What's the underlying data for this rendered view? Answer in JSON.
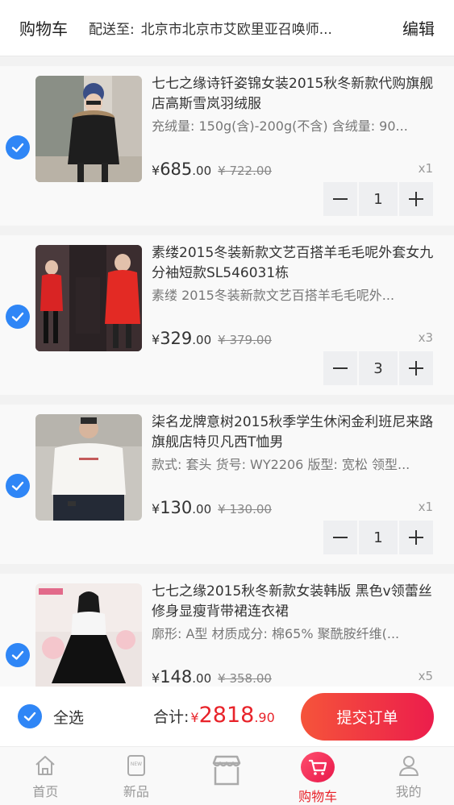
{
  "header": {
    "title": "购物车",
    "address_label": "配送至:",
    "address": "北京市北京市艾欧里亚召唤师...",
    "edit_label": "编辑"
  },
  "cart_items": [
    {
      "name": "七七之缘诗钎姿锦女装2015秋冬新款代购旗舰店高斯雪岚羽绒服",
      "spec": "充绒量: 150g(含)-200g(不含) 含绒量: 90...",
      "currency": "¥",
      "price_int": "685",
      "price_dec": ".00",
      "old_price": "¥ 722.00",
      "qty_label": "x1",
      "qty": "1",
      "checked": true
    },
    {
      "name": "素缕2015冬装新款文艺百搭羊毛毛呢外套女九分袖短款SL546031栋",
      "spec": "素缕 2015冬装新款文艺百搭羊毛毛呢外...",
      "currency": "¥",
      "price_int": "329",
      "price_dec": ".00",
      "old_price": "¥ 379.00",
      "qty_label": "x3",
      "qty": "3",
      "checked": true
    },
    {
      "name": "柒名龙牌意树2015秋季学生休闲金利班尼来路旗舰店特贝凡西T恤男",
      "spec": "款式: 套头 货号: WY2206 版型: 宽松 领型...",
      "currency": "¥",
      "price_int": "130",
      "price_dec": ".00",
      "old_price": "¥ 130.00",
      "qty_label": "x1",
      "qty": "1",
      "checked": true
    },
    {
      "name": "七七之缘2015秋冬新款女装韩版 黑色v领蕾丝修身显瘦背带裙连衣裙",
      "spec": "廓形: A型 材质成分: 棉65% 聚酰胺纤维(...",
      "currency": "¥",
      "price_int": "148",
      "price_dec": ".00",
      "old_price": "¥ 358.00",
      "qty_label": "x5",
      "qty": "5",
      "checked": true
    }
  ],
  "footer": {
    "select_all_label": "全选",
    "total_label": "合计:",
    "total_currency": "¥",
    "total_int": "2818",
    "total_dec": ".90",
    "submit_label": "提交订单"
  },
  "tabbar": [
    {
      "label": "首页",
      "icon": "home-icon",
      "active": false
    },
    {
      "label": "新品",
      "icon": "new-icon",
      "active": false
    },
    {
      "label": "",
      "icon": "store-icon",
      "active": false
    },
    {
      "label": "购物车",
      "icon": "cart-icon",
      "active": true
    },
    {
      "label": "我的",
      "icon": "user-icon",
      "active": false
    }
  ],
  "colors": {
    "accent_blue": "#2f86f6",
    "price_red": "#e8232a",
    "submit_gradient_start": "#f5543a",
    "submit_gradient_end": "#ec1d4c"
  }
}
